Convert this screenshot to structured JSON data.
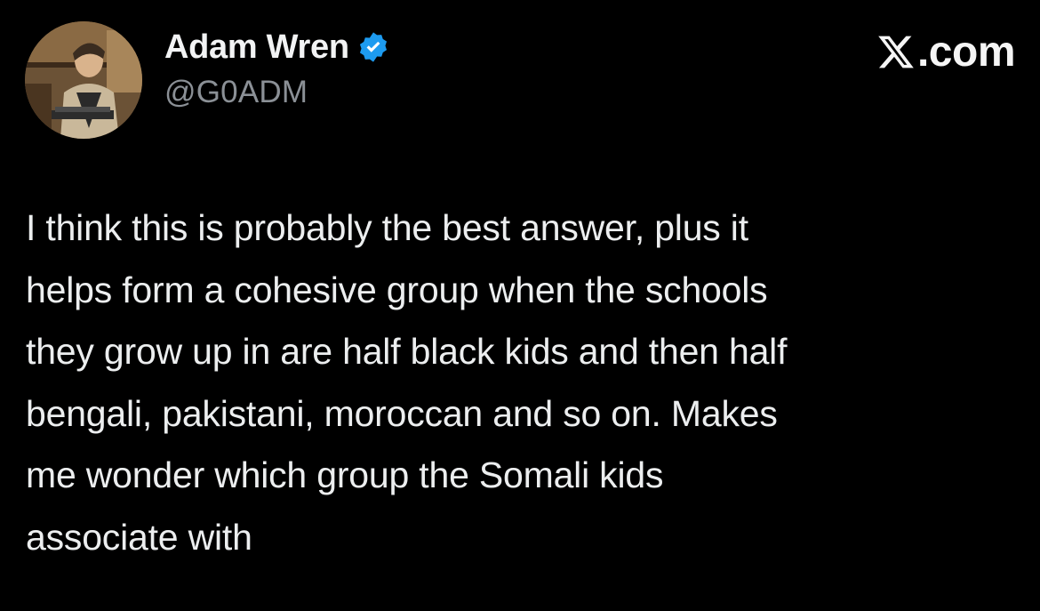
{
  "author": {
    "display_name": "Adam Wren",
    "handle": "@G0ADM",
    "verified": true,
    "avatar": "photo of a person seated at a laptop"
  },
  "site": {
    "logo": "x-logo-icon",
    "suffix": ".com"
  },
  "tweet": {
    "lines": [
      "I think this is probably the best answer, plus it",
      "helps form a cohesive group when the schools",
      "they grow up in are half black kids and then half",
      "bengali, pakistani, moroccan and so on. Makes",
      "me wonder which group the Somali kids",
      "associate with"
    ]
  },
  "colors": {
    "background": "#000000",
    "text": "#e7e9ea",
    "muted": "#8b9096",
    "verified_blue": "#1d9bf0"
  }
}
